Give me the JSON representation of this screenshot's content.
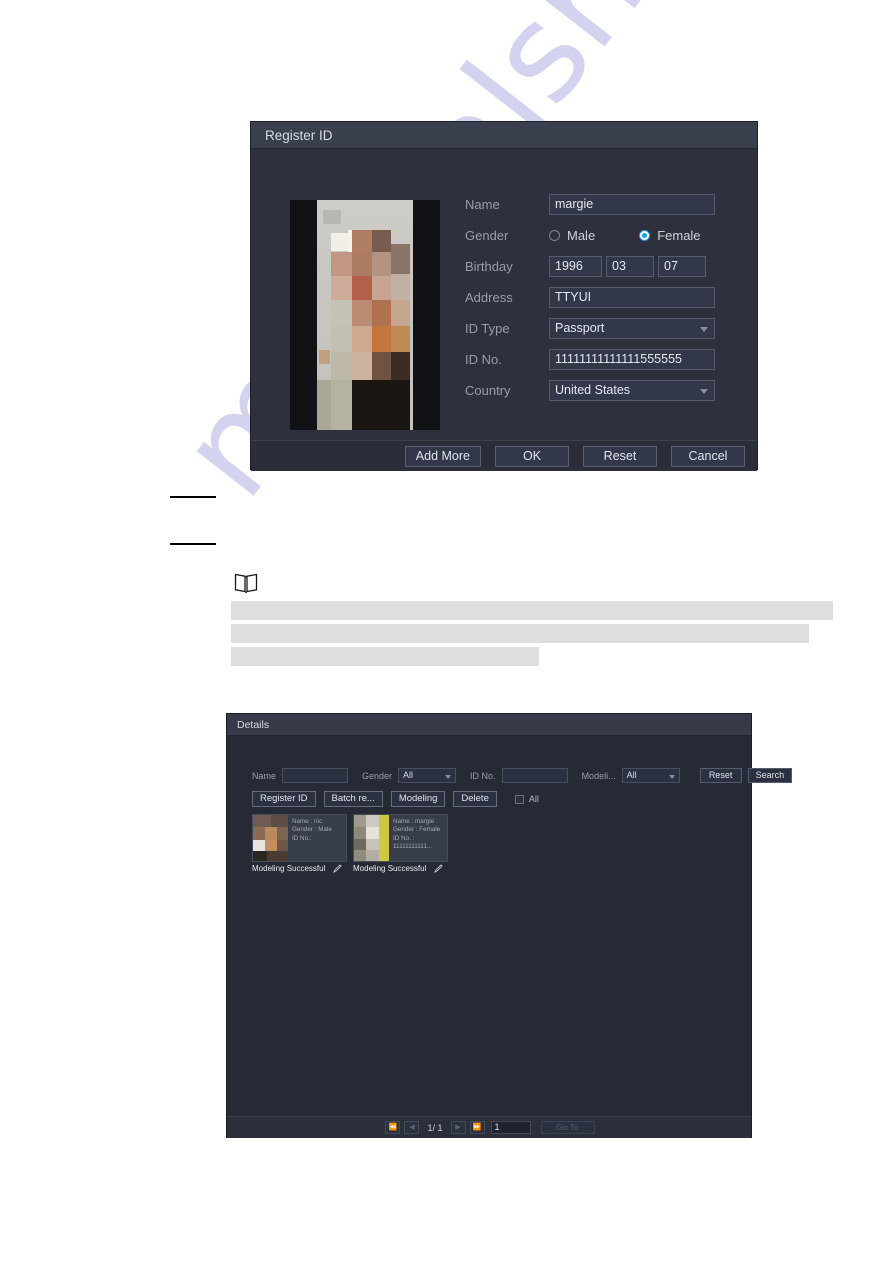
{
  "watermark": {
    "text": "manualshive.com"
  },
  "register_dialog": {
    "title": "Register ID",
    "fields": {
      "name_label": "Name",
      "name_value": "margie",
      "gender_label": "Gender",
      "gender_male": "Male",
      "gender_female": "Female",
      "gender_selected": "Female",
      "birthday_label": "Birthday",
      "birthday_year": "1996",
      "birthday_month": "03",
      "birthday_day": "07",
      "address_label": "Address",
      "address_value": "TTYUI",
      "idtype_label": "ID Type",
      "idtype_value": "Passport",
      "idno_label": "ID No.",
      "idno_value": "11111111111111555555",
      "country_label": "Country",
      "country_value": "United States"
    },
    "buttons": {
      "add_more": "Add More",
      "ok": "OK",
      "reset": "Reset",
      "cancel": "Cancel"
    }
  },
  "details_dialog": {
    "title": "Details",
    "search": {
      "name_label": "Name",
      "name_value": "",
      "gender_label": "Gender",
      "gender_value": "All",
      "idno_label": "ID No.",
      "idno_value": "",
      "modeling_label": "Modeli...",
      "modeling_value": "All",
      "reset_button": "Reset",
      "search_button": "Search"
    },
    "actions": {
      "register_id": "Register ID",
      "batch_register": "Batch re...",
      "modeling": "Modeling",
      "delete": "Delete",
      "select_all": "All"
    },
    "cards": [
      {
        "name_line": "Name : nic",
        "gender_line": "Gender : Male",
        "idno_line": "ID No.:",
        "idno_line2": "",
        "status": "Modeling Successful"
      },
      {
        "name_line": "Name : margie",
        "gender_line": "Gender : Female",
        "idno_line": "ID No. :",
        "idno_line2": "11111111111...",
        "status": "Modeling Successful"
      }
    ],
    "pagination": {
      "first": "⏪",
      "prev": "◀",
      "page_info": "1/ 1",
      "next": "▶",
      "last": "⏩",
      "page_input": "1",
      "goto": "Go To"
    }
  },
  "colors": {
    "accent_blue": "#1c9fe0",
    "dialog_bg": "#2e313d",
    "titlebar_bg": "#3a3f4d",
    "watermark": "#b9b9e8",
    "redaction_gray": "#dededf"
  }
}
